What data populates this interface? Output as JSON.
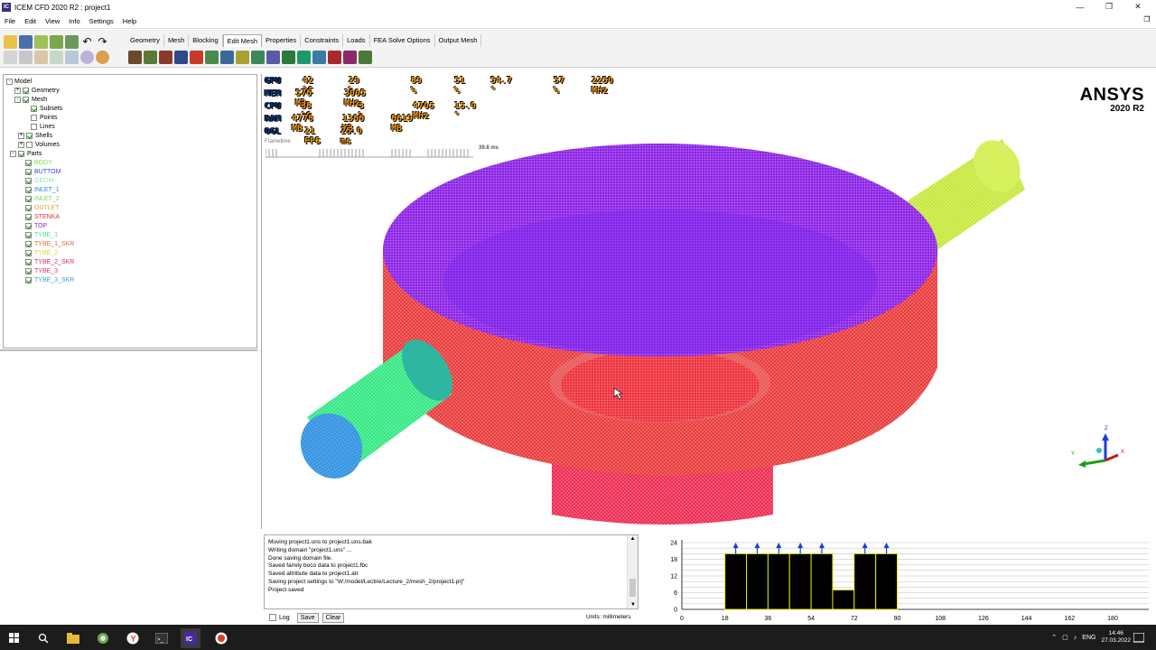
{
  "window": {
    "title": "ICEM CFD 2020 R2 : project1",
    "app_icon": "IC"
  },
  "window_buttons": [
    "minimize-icon",
    "maximize-icon",
    "close-icon"
  ],
  "menu": [
    "File",
    "Edit",
    "View",
    "Info",
    "Settings",
    "Help"
  ],
  "tabs": [
    "Geometry",
    "Mesh",
    "Blocking",
    "Edit Mesh",
    "Properties",
    "Constraints",
    "Loads",
    "FEA Solve Options",
    "Output Mesh"
  ],
  "active_tab": "Edit Mesh",
  "tree": {
    "root": "Model",
    "geometry": "Geometry",
    "mesh": "Mesh",
    "mesh_items": [
      "Subsets",
      "Points",
      "Lines",
      "Shells",
      "Volumes"
    ],
    "parts_label": "Parts",
    "parts": [
      {
        "name": "BODY",
        "color": "#7fdc4a"
      },
      {
        "name": "BUTTOM",
        "color": "#2f4fd6"
      },
      {
        "name": "GEOM",
        "color": "#8fe6a6"
      },
      {
        "name": "INLET_1",
        "color": "#1f8ae0"
      },
      {
        "name": "INLET_2",
        "color": "#6fe15a"
      },
      {
        "name": "OUTLET",
        "color": "#e0a33a"
      },
      {
        "name": "STENKA",
        "color": "#e53a2a"
      },
      {
        "name": "TOP",
        "color": "#9b22d6"
      },
      {
        "name": "TYBE_1",
        "color": "#4fdc9b"
      },
      {
        "name": "TYBE_1_SKR",
        "color": "#e06a3a"
      },
      {
        "name": "TYBE_2",
        "color": "#d8d642"
      },
      {
        "name": "TYBE_2_SKR",
        "color": "#d0306a"
      },
      {
        "name": "TYBE_3",
        "color": "#e0307a"
      },
      {
        "name": "TYBE_3_SKR",
        "color": "#3aa6c8"
      }
    ]
  },
  "overlay": {
    "rows": [
      {
        "key": "GPU",
        "vals": [
          "42 °C",
          "29 %",
          "89 %",
          "51 %",
          "54.7 °",
          "57 %",
          "2250 MHz"
        ]
      },
      {
        "key": "MEM",
        "vals": [
          "576 MB",
          "3005 MHz"
        ]
      },
      {
        "key": "CPU",
        "vals": [
          "38 °C",
          "3 %",
          "4705 MHz",
          "15.0 °"
        ]
      },
      {
        "key": "RAM",
        "vals": [
          "4778 MB",
          "1366 MB",
          "6619 MB"
        ]
      },
      {
        "key": "OGL",
        "vals": [
          "21 FPS",
          "25.0 ms"
        ]
      }
    ],
    "frametime_label": "Frametime",
    "frametime_value": "39.8 ms"
  },
  "brand": {
    "name": "ANSYS",
    "version": "2020 R2"
  },
  "axes": {
    "z": "Z",
    "x": "X",
    "y": "Y"
  },
  "console": {
    "lines": [
      "Moving project1.uns to project1.uns.bak",
      "Writing domain \"project1.uns\" ...",
      "Done saving domain file.",
      "Saved family boco data to project1.fbc",
      "Saved attribute data to project1.atr",
      "Saving project settings to \"W:/model/Lectire/Lecture_2/mesh_2/project1.prj\"",
      "Project saved"
    ],
    "log_label": "Log",
    "save_label": "Save",
    "clear_label": "Clear",
    "units": "Units: millimeters"
  },
  "histogram": {
    "y_ticks": [
      "24",
      "18",
      "12",
      "6",
      "0"
    ],
    "x_ticks": [
      "0",
      "18",
      "36",
      "54",
      "72",
      "90",
      "108",
      "126",
      "144",
      "162",
      "180"
    ]
  },
  "chart_data": {
    "type": "bar",
    "categories": [
      "18-27",
      "27-36",
      "36-45",
      "45-54",
      "54-63",
      "63-72",
      "72-81",
      "81-90"
    ],
    "values": [
      20,
      20,
      20,
      20,
      20,
      7,
      20,
      20
    ],
    "xlabel": "",
    "ylabel": "",
    "xlim": [
      0,
      180
    ],
    "ylim": [
      0,
      24
    ],
    "bar_color": "#000000",
    "bar_outline": "#e6e600",
    "marker_color": "#1a3fd6"
  },
  "taskbar": {
    "apps": [
      "windows-start-icon",
      "search-icon",
      "file-explorer-icon",
      "browser-icon",
      "yandex-icon",
      "terminal-icon",
      "icem-cfd-icon",
      "recorder-icon"
    ],
    "lang": "ENG",
    "time": "14:46",
    "date": "27.03.2022"
  }
}
